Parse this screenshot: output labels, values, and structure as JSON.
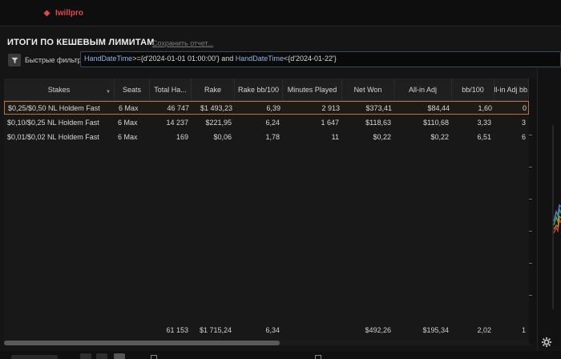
{
  "app": {
    "logo_text": "Iwillpro"
  },
  "report": {
    "title": "ИТОГИ ПО КЕШЕВЫМ ЛИМИТАМ",
    "save_link": "Сохранить отчет..."
  },
  "filter": {
    "label": "Быстрые фильтры",
    "expression": {
      "field1": "HandDateTime",
      "part1": ">={d'2024-01-01 01:00:00'} and ",
      "field2": "HandDateTime",
      "part2": "<{d'2024-01-22'}"
    }
  },
  "table": {
    "columns": [
      {
        "key": "stakes",
        "label": "Stakes"
      },
      {
        "key": "seats",
        "label": "Seats"
      },
      {
        "key": "total_hands",
        "label": "Total Ha..."
      },
      {
        "key": "rake",
        "label": "Rake"
      },
      {
        "key": "rake_bb100",
        "label": "Rake bb/100"
      },
      {
        "key": "minutes",
        "label": "Minutes Played"
      },
      {
        "key": "net_won",
        "label": "Net Won"
      },
      {
        "key": "allin_adj",
        "label": "All-in Adj"
      },
      {
        "key": "bb100",
        "label": "bb/100"
      },
      {
        "key": "allin_adj_bb",
        "label": "All-in Adj bb..."
      }
    ],
    "rows": [
      {
        "stakes": "$0,25/$0,50 NL Holdem Fast",
        "seats": "6 Max",
        "total_hands": "46 747",
        "rake": "$1 493,23",
        "rake_bb100": "6,39",
        "minutes": "2 913",
        "net_won": "$373,41",
        "allin_adj": "$84,44",
        "bb100": "1,60",
        "allin_adj_bb": "0"
      },
      {
        "stakes": "$0,10/$0,25 NL Holdem Fast",
        "seats": "6 Max",
        "total_hands": "14 237",
        "rake": "$221,95",
        "rake_bb100": "6,24",
        "minutes": "1 647",
        "net_won": "$118,63",
        "allin_adj": "$110,68",
        "bb100": "3,33",
        "allin_adj_bb": "3"
      },
      {
        "stakes": "$0,01/$0,02 NL Holdem Fast",
        "seats": "6 Max",
        "total_hands": "169",
        "rake": "$0,06",
        "rake_bb100": "1,78",
        "minutes": "11",
        "net_won": "$0,22",
        "allin_adj": "$0,22",
        "bb100": "6,51",
        "allin_adj_bb": "6"
      }
    ],
    "totals": {
      "total_hands": "61 153",
      "rake": "$1 715,24",
      "rake_bb100": "6,34",
      "net_won": "$492,26",
      "allin_adj": "$195,34",
      "bb100": "2,02",
      "allin_adj_bb": "1"
    }
  },
  "colors": {
    "positive": "#8fdc8a",
    "selected_border": "#b8743a",
    "logo": "#e04848",
    "keyword": "#8fb7e6"
  },
  "icons": {
    "logo": "poker-suit-icon",
    "filter": "funnel-icon",
    "sort": "sort-desc-icon",
    "settings": "gear-icon"
  }
}
